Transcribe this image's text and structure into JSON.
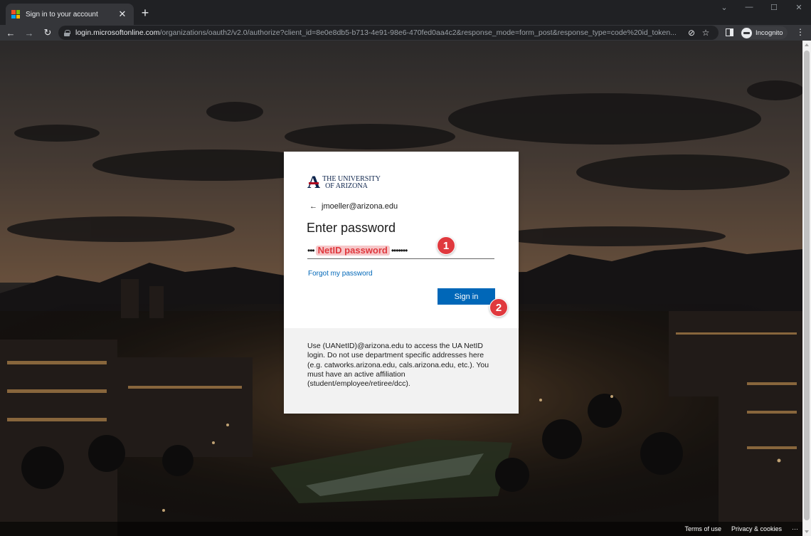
{
  "browser": {
    "tab_title": "Sign in to your account",
    "tab_close": "✕",
    "new_tab": "+",
    "url_host": "login.microsoftonline.com",
    "url_path": "/organizations/oauth2/v2.0/authorize?client_id=8e0e8db5-b713-4e91-98e6-470fed0aa4c2&response_mode=form_post&response_type=code%20id_token...",
    "incognito_label": "Incognito",
    "ms_logo_colors": [
      "#f25022",
      "#7fba00",
      "#00a4ef",
      "#ffb900"
    ]
  },
  "signin": {
    "logo_line1": "THE UNIVERSITY",
    "logo_line2": "OF ARIZONA",
    "logo_letter": "A",
    "back_arrow": "←",
    "identity": "jmoeller@arizona.edu",
    "heading": "Enter password",
    "password_dots_left": "•••",
    "password_hint": "NetID password",
    "password_dots_right": "•••••••",
    "forgot_link": "Forgot my password",
    "signin_button": "Sign in",
    "footer_text": "Use (UANetID)@arizona.edu to access the UA NetID login. Do not use department specific addresses here (e.g. catworks.arizona.edu, cals.arizona.edu, etc.). You must have an active affiliation (student/employee/retiree/dcc)."
  },
  "annotations": {
    "step1": "1",
    "step2": "2"
  },
  "page_footer": {
    "terms": "Terms of use",
    "privacy": "Privacy & cookies",
    "more": "···"
  },
  "colors": {
    "accent_blue": "#0067b8",
    "badge_red": "#e0393e",
    "ua_navy": "#0c234b",
    "ua_red": "#ab0520"
  }
}
